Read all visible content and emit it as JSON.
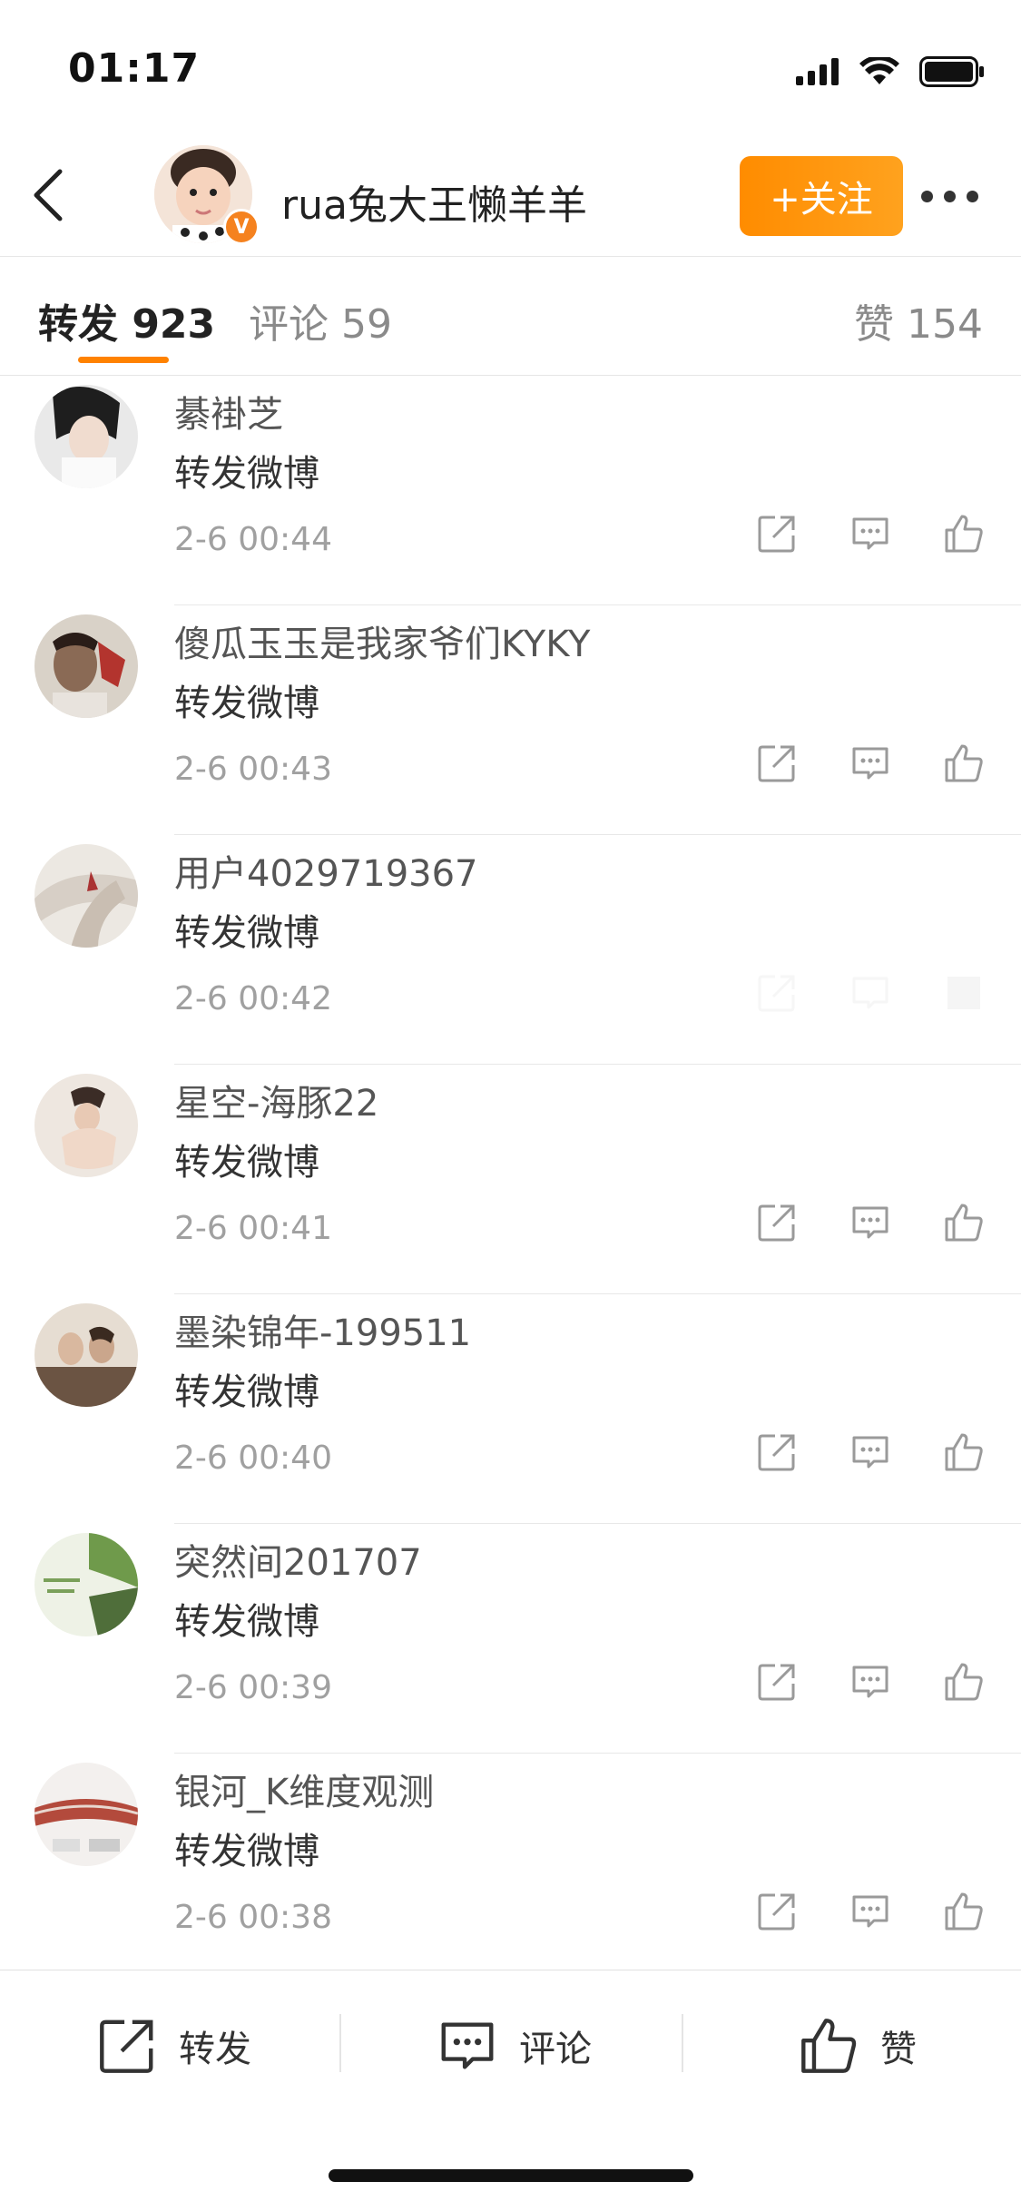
{
  "status": {
    "time": "01:17"
  },
  "header": {
    "username": "rua兔大王懒羊羊",
    "verified_badge": "V",
    "follow_label": "+关注"
  },
  "tabs": {
    "repost": "转发 923",
    "comment": "评论 59",
    "like": "赞 154"
  },
  "reposts": [
    {
      "name": "綦褂芝",
      "text": "转发微博",
      "time": "2-6 00:44"
    },
    {
      "name": "傻瓜玉玉是我家爷们KYKY",
      "text": "转发微博",
      "time": "2-6 00:43"
    },
    {
      "name": "用户4029719367",
      "text": "转发微博",
      "time": "2-6 00:42"
    },
    {
      "name": "星空-海豚22",
      "text": "转发微博",
      "time": "2-6 00:41"
    },
    {
      "name": "墨染锦年-199511",
      "text": "转发微博",
      "time": "2-6 00:40"
    },
    {
      "name": "突然间201707",
      "text": "转发微博",
      "time": "2-6 00:39"
    },
    {
      "name": "银河_K维度观测",
      "text": "转发微博",
      "time": "2-6 00:38"
    }
  ],
  "bottom_bar": {
    "repost_label": "转发",
    "comment_label": "评论",
    "like_label": "赞"
  },
  "colors": {
    "accent": "#ff8200",
    "text_secondary": "#a0a0a0"
  }
}
